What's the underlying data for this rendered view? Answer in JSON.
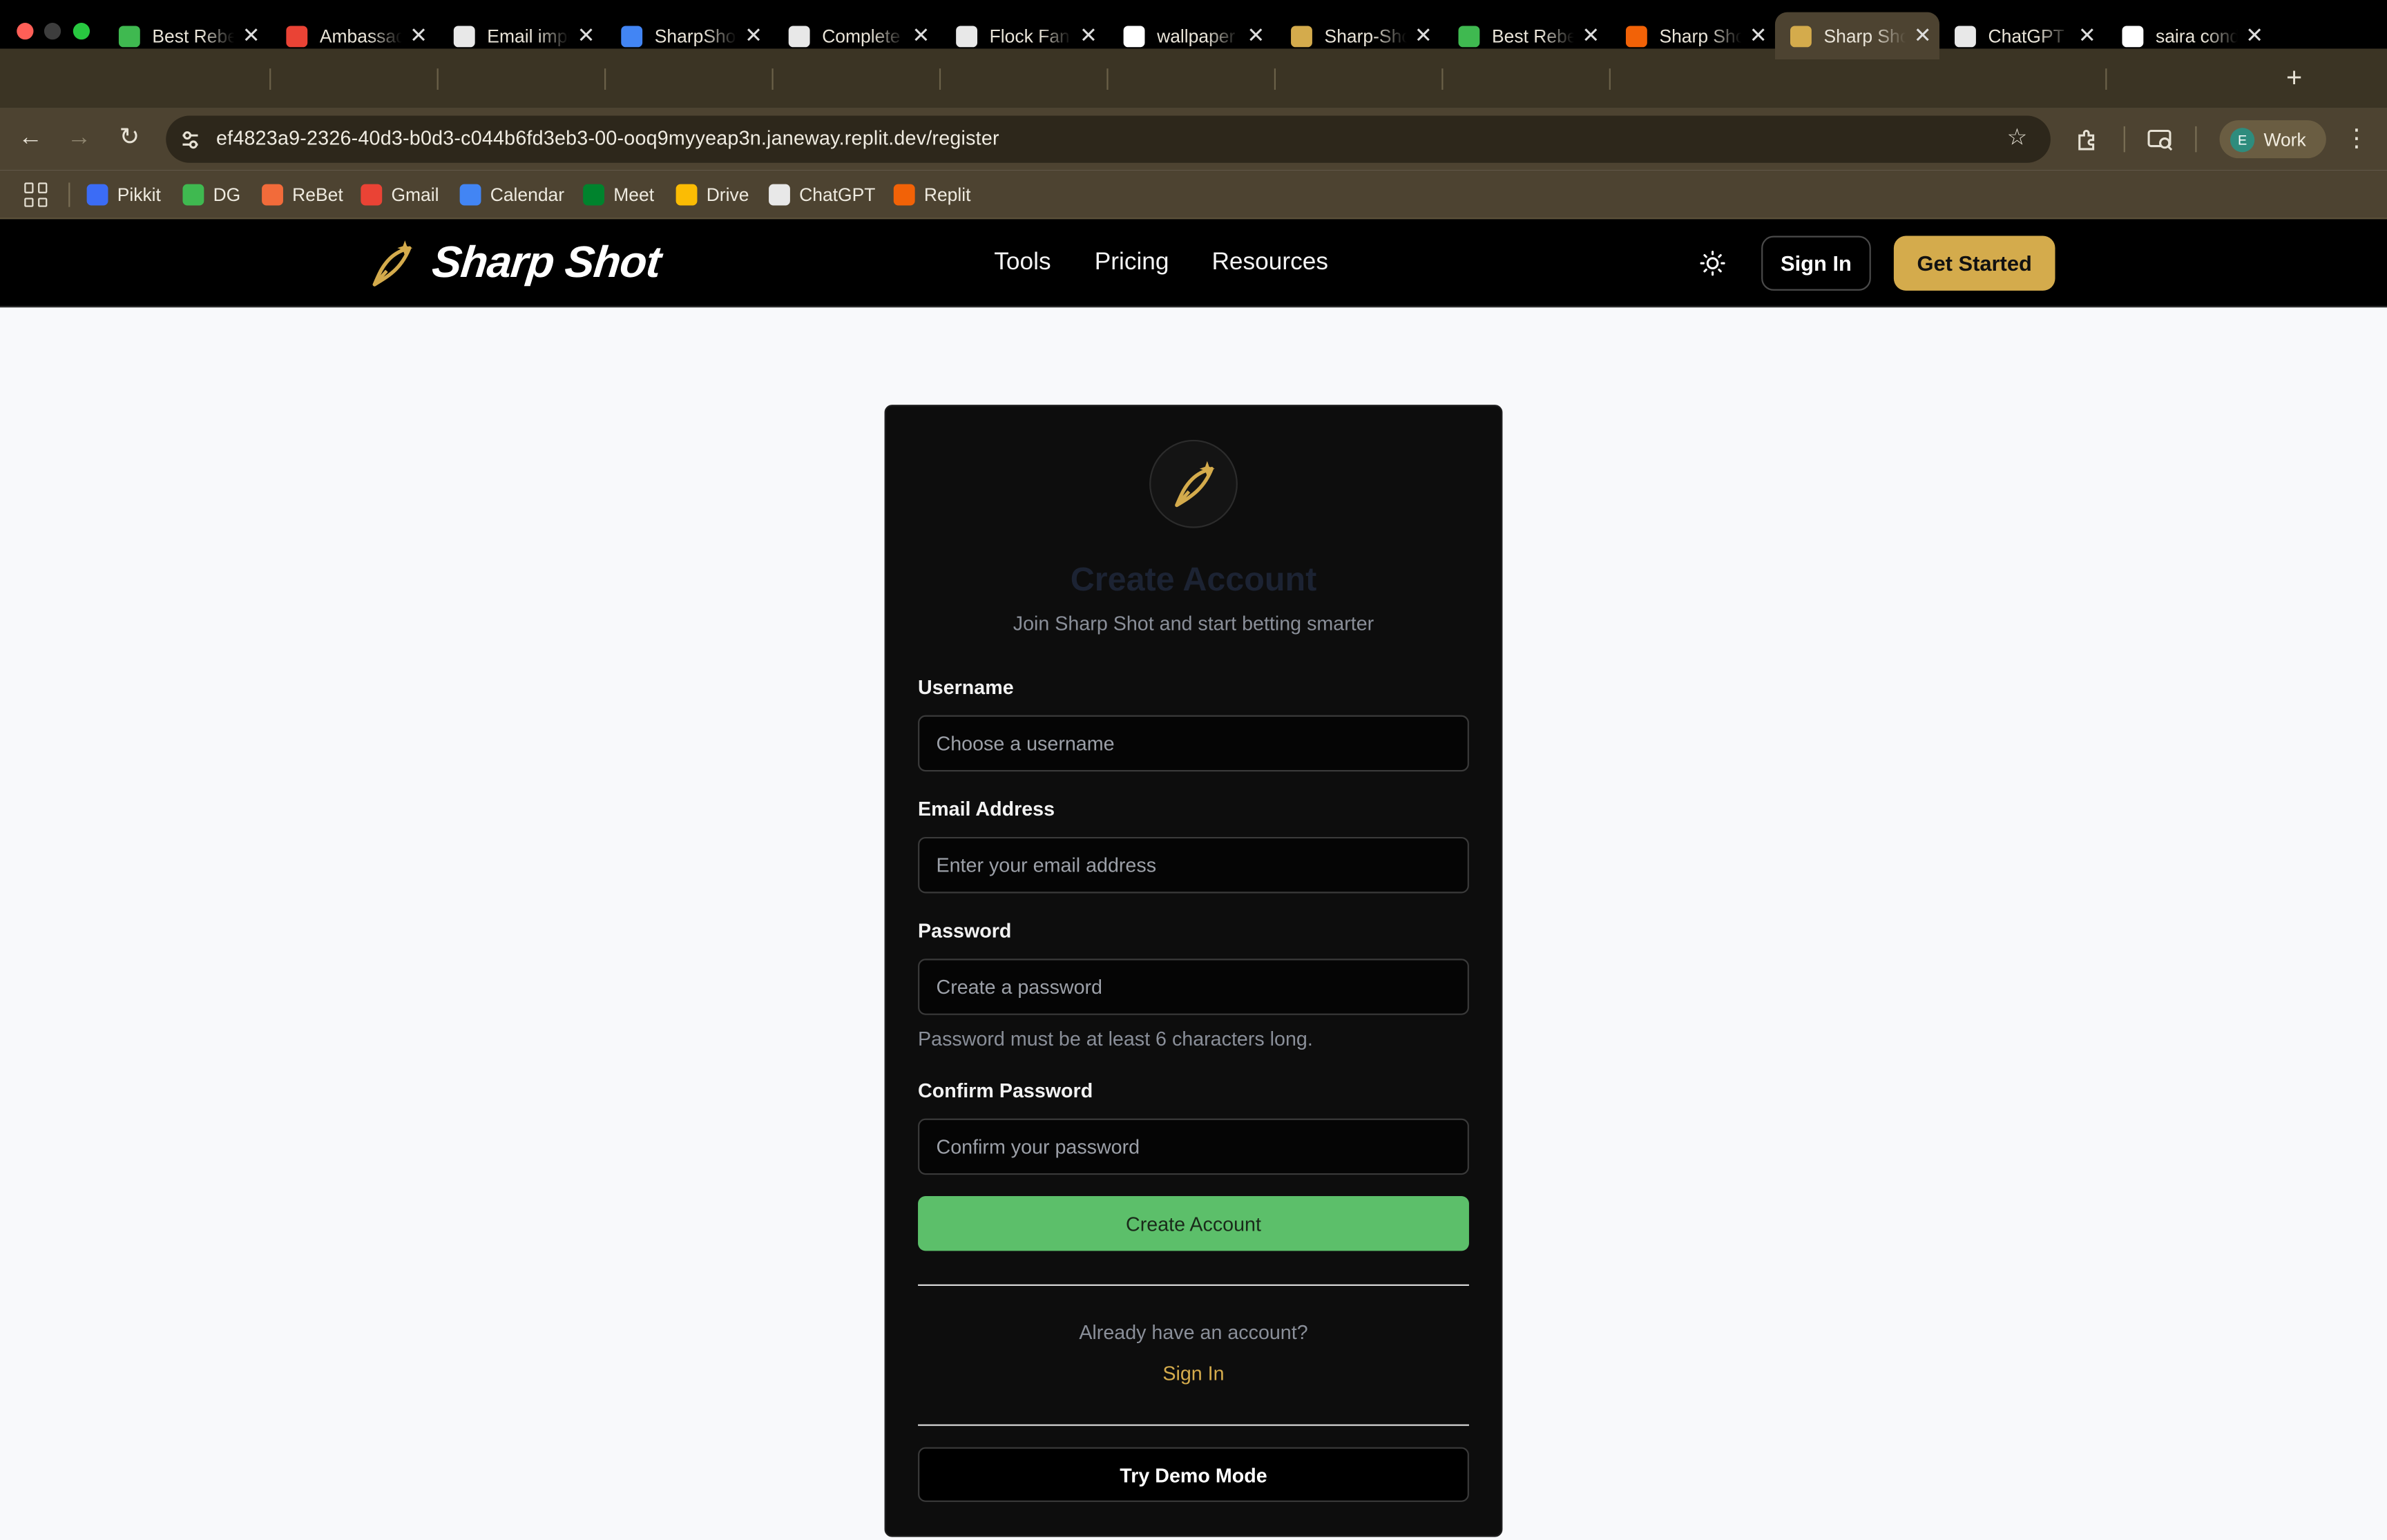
{
  "browser": {
    "tabs": [
      {
        "label": "Best Rebet",
        "icon": "dg-link-icon",
        "color": "#3fb950"
      },
      {
        "label": "Ambassador",
        "icon": "gmail-icon",
        "color": "#ea4335"
      },
      {
        "label": "Email improve",
        "icon": "chatgpt-icon",
        "color": "#e8e8e8"
      },
      {
        "label": "SharpShot",
        "icon": "calendar-icon",
        "color": "#4285f4"
      },
      {
        "label": "Complete",
        "icon": "github-icon",
        "color": "#e8e8e8"
      },
      {
        "label": "Flock Fan",
        "icon": "bird-icon",
        "color": "#e8e8e8"
      },
      {
        "label": "wallpaper",
        "icon": "google-icon",
        "color": "#ffffff"
      },
      {
        "label": "Sharp-Shot",
        "icon": "sharpshot-icon",
        "color": "#d4ab4c"
      },
      {
        "label": "Best Rebet",
        "icon": "dg-link-icon",
        "color": "#3fb950"
      },
      {
        "label": "Sharp Shot",
        "icon": "replit-icon",
        "color": "#f26207"
      },
      {
        "label": "Sharp Shot",
        "icon": "sharpshot-icon",
        "color": "#d4ab4c"
      },
      {
        "label": "ChatGPT",
        "icon": "chatgpt-icon",
        "color": "#e8e8e8"
      },
      {
        "label": "saira cond",
        "icon": "google-icon",
        "color": "#ffffff"
      }
    ],
    "active_tab": 10,
    "new_tab_label": "+",
    "url": "ef4823a9-2326-40d3-b0d3-c044b6fd3eb3-00-ooq9myyeap3n.janeway.replit.dev/register",
    "profile": {
      "initial": "E",
      "name": "Work"
    },
    "bookmarks": [
      {
        "label": "Pikkit",
        "icon": "pikkit-icon",
        "color": "#3b6cf6"
      },
      {
        "label": "DG",
        "icon": "dg-link-icon",
        "color": "#3fb950"
      },
      {
        "label": "ReBet",
        "icon": "rebet-icon",
        "color": "#f26b3a"
      },
      {
        "label": "Gmail",
        "icon": "gmail-icon",
        "color": "#ea4335"
      },
      {
        "label": "Calendar",
        "icon": "calendar-icon",
        "color": "#4285f4"
      },
      {
        "label": "Meet",
        "icon": "meet-icon",
        "color": "#00832d"
      },
      {
        "label": "Drive",
        "icon": "drive-icon",
        "color": "#fbbc04"
      },
      {
        "label": "ChatGPT",
        "icon": "chatgpt-icon",
        "color": "#e8e8e8"
      },
      {
        "label": "Replit",
        "icon": "replit-icon",
        "color": "#f26207"
      }
    ]
  },
  "site": {
    "brand": "Sharp Shot",
    "nav": {
      "tools": "Tools",
      "pricing": "Pricing",
      "resources": "Resources"
    },
    "sign_in": "Sign In",
    "get_started": "Get Started",
    "accent": "#d4ab4c"
  },
  "form": {
    "title": "Create Account",
    "subtitle": "Join Sharp Shot and start betting smarter",
    "username": {
      "label": "Username",
      "placeholder": "Choose a username"
    },
    "email": {
      "label": "Email Address",
      "placeholder": "Enter your email address"
    },
    "password": {
      "label": "Password",
      "placeholder": "Create a password",
      "hint": "Password must be at least 6 characters long."
    },
    "confirm": {
      "label": "Confirm Password",
      "placeholder": "Confirm your password"
    },
    "submit": "Create Account",
    "submit_color": "#5cbf6a",
    "already": "Already have an account?",
    "sign_in_link": "Sign In",
    "demo": "Try Demo Mode"
  }
}
